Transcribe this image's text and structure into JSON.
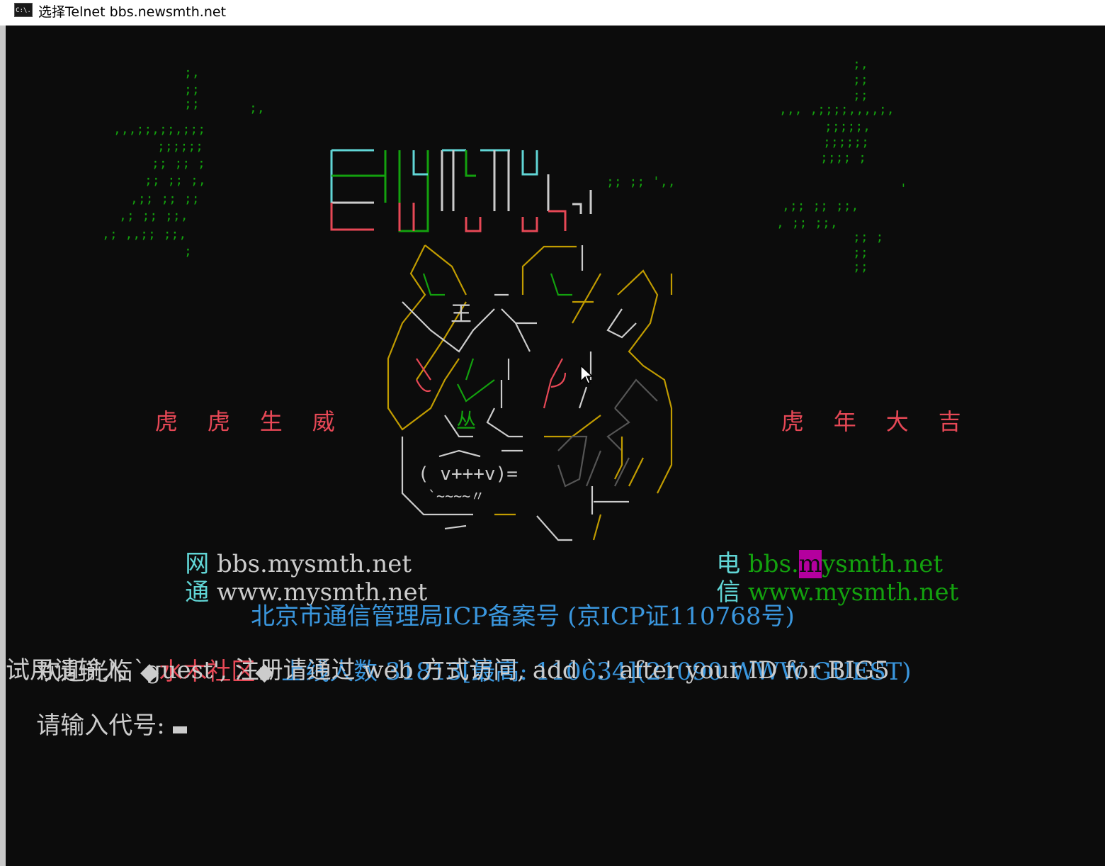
{
  "window": {
    "icon_text": "C:\\.",
    "title": "选择Telnet bbs.newsmth.net"
  },
  "banner": {
    "left_motto": [
      "虎",
      "虎",
      "生",
      "威"
    ],
    "right_motto": [
      "虎",
      "年",
      "大",
      "吉"
    ],
    "center_glyph_top": "王",
    "center_glyph_mid": "丛",
    "center_face": "( v+++v)=",
    "center_whiskers": "`~~~~〃"
  },
  "links": {
    "left": [
      {
        "label": "网",
        "url": "bbs.mysmth.net"
      },
      {
        "label": "通",
        "url": "www.mysmth.net"
      }
    ],
    "right": [
      {
        "label": "电",
        "url_prefix": "bbs.",
        "url_highlight": "m",
        "url_rest": "ysmth.net"
      },
      {
        "label": "信",
        "url": "www.mysmth.net"
      }
    ]
  },
  "icp": "北京市通信管理局ICP备案号 (京ICP证110768号)",
  "welcome": {
    "prefix": "欢迎光临 ",
    "diamond_left": "◆",
    "community": "水木社区",
    "diamond_right": "◆ ",
    "online_label": "上线人数",
    "online_stats": " 31813[最高: 110634](21090 WWW GUEST)"
  },
  "instructions": "试用请输入 `guest', 注册请通过 web 方式访问, add `.' after your ID for BIG5",
  "prompt": "请输入代号: ",
  "colors": {
    "console_bg": "#0c0c0c",
    "green": "#13a10e",
    "cyan": "#3a96dd",
    "red": "#e74856",
    "white": "#cccccc",
    "magenta": "#b4009e"
  }
}
